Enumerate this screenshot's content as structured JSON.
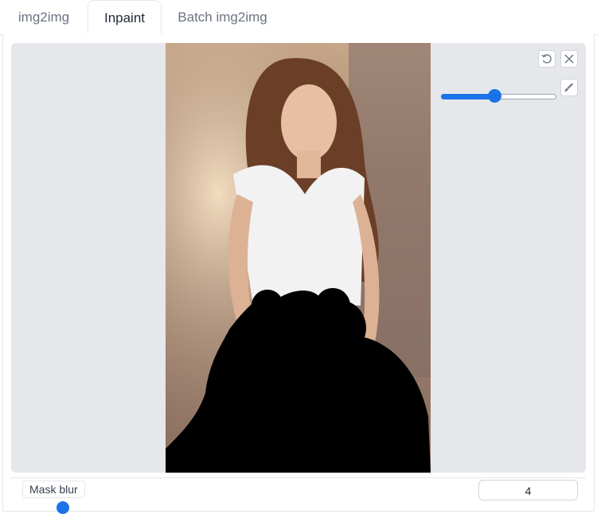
{
  "tabs": [
    "img2img",
    "Inpaint",
    "Batch img2img"
  ],
  "active_tab": "Inpaint",
  "canvas": {
    "image_description": "woman in white t-shirt with painted black mask",
    "brush_size_fraction": 0.47
  },
  "controls": {
    "undo_icon": "undo-icon",
    "clear_icon": "close-icon",
    "brush_icon": "brush-icon"
  },
  "mask_blur": {
    "label": "Mask blur",
    "value": "4"
  },
  "colors": {
    "accent": "#1a73e8",
    "canvas_bg": "#e5e7eb"
  }
}
